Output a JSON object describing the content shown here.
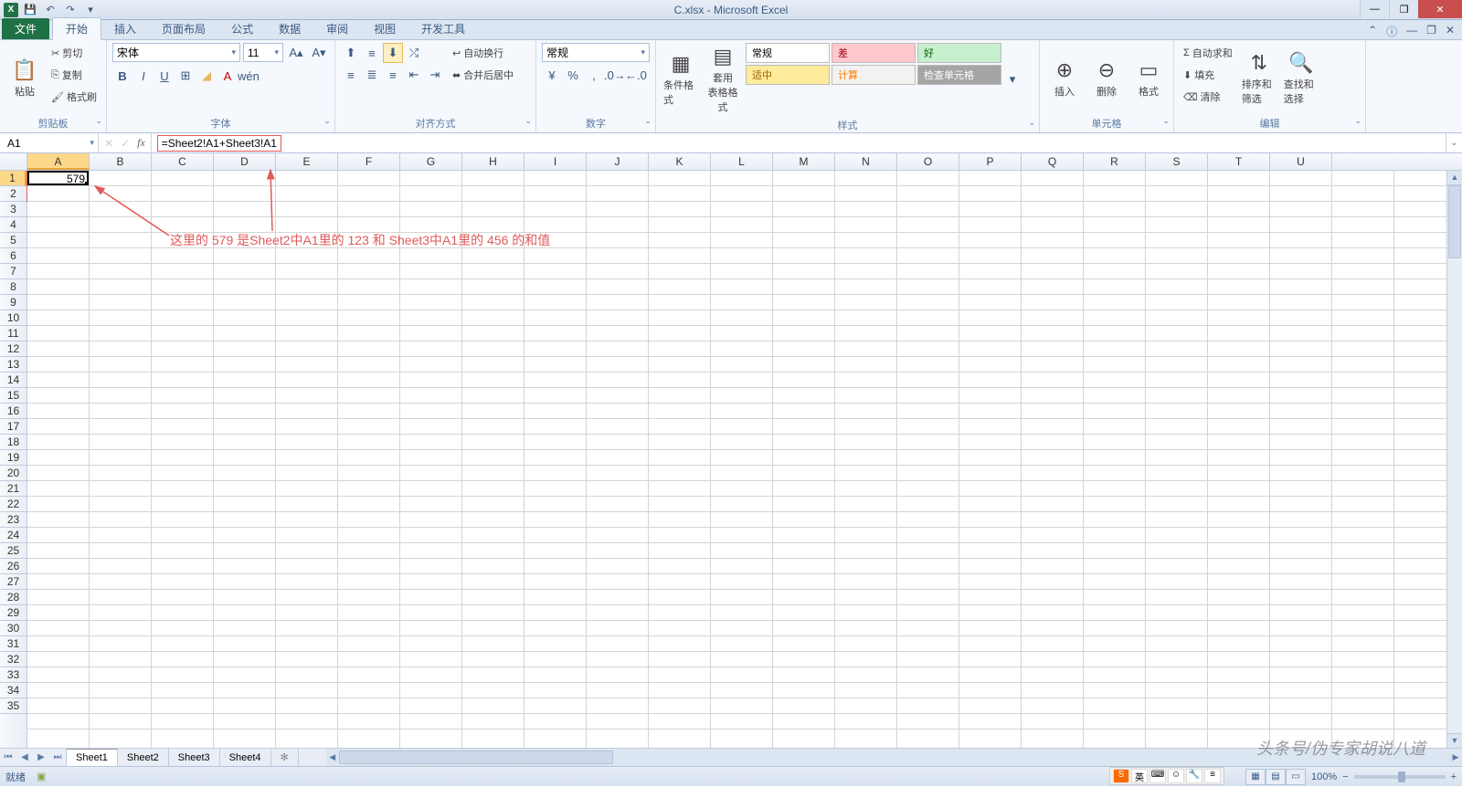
{
  "title": "C.xlsx - Microsoft Excel",
  "tabs": {
    "file": "文件",
    "items": [
      "开始",
      "插入",
      "页面布局",
      "公式",
      "数据",
      "审阅",
      "视图",
      "开发工具"
    ],
    "active": 0
  },
  "ribbon": {
    "clipboard": {
      "label": "剪贴板",
      "paste": "粘贴",
      "cut": "剪切",
      "copy": "复制",
      "format_painter": "格式刷"
    },
    "font": {
      "label": "字体",
      "name": "宋体",
      "size": "11"
    },
    "alignment": {
      "label": "对齐方式",
      "wrap": "自动换行",
      "merge": "合并后居中"
    },
    "number": {
      "label": "数字",
      "format": "常规"
    },
    "styles": {
      "label": "样式",
      "cond": "条件格式",
      "table": "套用\n表格格式",
      "s1": "常规",
      "s2": "差",
      "s3": "好",
      "s4": "适中",
      "s5": "计算",
      "s6": "检查单元格"
    },
    "cells": {
      "label": "单元格",
      "insert": "插入",
      "delete": "删除",
      "format": "格式"
    },
    "editing": {
      "label": "编辑",
      "autosum": "自动求和",
      "fill": "填充",
      "clear": "清除",
      "sort": "排序和筛选",
      "find": "查找和选择"
    }
  },
  "namebox": "A1",
  "formula": "=Sheet2!A1+Sheet3!A1",
  "columns": [
    "A",
    "B",
    "C",
    "D",
    "E",
    "F",
    "G",
    "H",
    "I",
    "J",
    "K",
    "L",
    "M",
    "N",
    "O",
    "P",
    "Q",
    "R",
    "S",
    "T",
    "U"
  ],
  "cell_value": "579",
  "annotation_text": "这里的 579   是Sheet2中A1里的 123   和 Sheet3中A1里的 456   的和值",
  "sheets": [
    "Sheet1",
    "Sheet2",
    "Sheet3",
    "Sheet4"
  ],
  "active_sheet": 0,
  "status": {
    "ready": "就绪",
    "zoom": "100%"
  },
  "watermark": "头条号/伪专家胡说八道",
  "ime": {
    "label": "英"
  }
}
